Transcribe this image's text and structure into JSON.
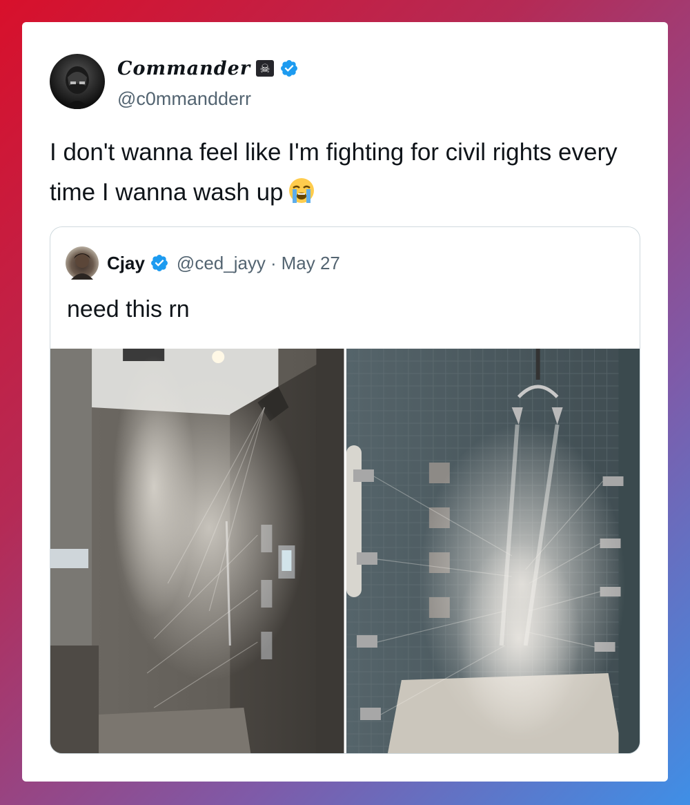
{
  "tweet": {
    "author_name": "Commander",
    "author_handle": "@c0mmandderr",
    "badge_icon": "skull-crossbones-icon",
    "verified_color": "#1d9bf0",
    "text": "I don't wanna feel like I'm fighting for civil rights every time I wanna wash up",
    "emoji": "loudly-crying-face-icon"
  },
  "quoted_tweet": {
    "author_name": "Cjay",
    "author_handle": "@ced_jayy",
    "separator": "·",
    "date": "May 27",
    "text": "need this rn",
    "media": [
      {
        "description_icon": "rainfall-shower-photo"
      },
      {
        "description_icon": "multi-jet-shower-photo"
      }
    ]
  }
}
